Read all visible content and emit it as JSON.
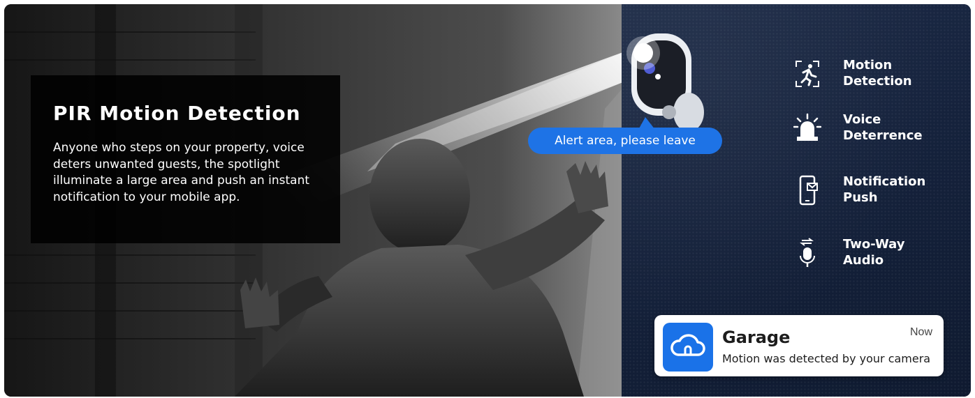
{
  "headline": {
    "title": "PIR Motion Detection",
    "body": "Anyone who steps on your property, voice deters unwanted guests, the spotlight illuminate a large area and push an instant notification to your mobile app."
  },
  "alert_bubble": {
    "text": "Alert area, please leave"
  },
  "features": [
    {
      "icon": "motion-runner-icon",
      "line1": "Motion",
      "line2": "Detection"
    },
    {
      "icon": "siren-icon",
      "line1": "Voice",
      "line2": "Deterrence"
    },
    {
      "icon": "phone-notification-icon",
      "line1": "Notification",
      "line2": "Push"
    },
    {
      "icon": "microphone-arrows-icon",
      "line1": "Two-Way",
      "line2": "Audio"
    }
  ],
  "notification": {
    "app_icon": "cloud-icon",
    "title": "Garage",
    "time": "Now",
    "message": "Motion was detected by your camera"
  },
  "colors": {
    "accent_blue": "#1e73e6",
    "right_panel": "#17243f",
    "text_white": "#ffffff"
  }
}
